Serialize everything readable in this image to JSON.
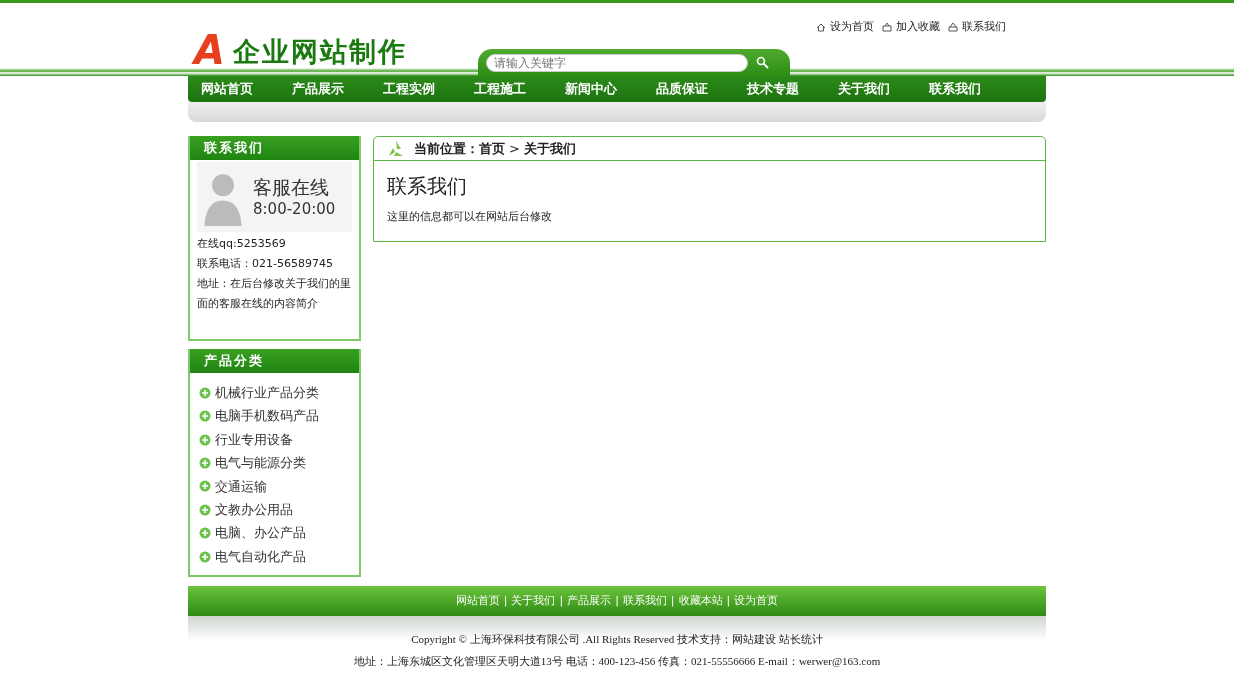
{
  "header": {
    "logo_letter": "A",
    "logo_text": "企业网站制作",
    "top_links": [
      {
        "kind": "home",
        "label": "设为首页"
      },
      {
        "kind": "favorite",
        "label": "加入收藏"
      },
      {
        "kind": "contact",
        "label": "联系我们"
      }
    ],
    "search": {
      "placeholder": "请输入关键字"
    }
  },
  "nav": [
    {
      "label": "网站首页",
      "selected": false
    },
    {
      "label": "产品展示",
      "selected": false
    },
    {
      "label": "工程实例",
      "selected": false
    },
    {
      "label": "工程施工",
      "selected": false
    },
    {
      "label": "新闻中心",
      "selected": false
    },
    {
      "label": "品质保证",
      "selected": false
    },
    {
      "label": "技术专题",
      "selected": false
    },
    {
      "label": "关于我们",
      "selected": false
    },
    {
      "label": "联系我们",
      "selected": false
    }
  ],
  "contact_box": {
    "title": "联系我们",
    "banner_title": "客服在线",
    "banner_hours": "8:00-20:00",
    "lines": [
      "在线qq:5253569",
      "联系电话：021-56589745",
      "地址：在后台修改关于我们的里面的客服在线的内容简介"
    ]
  },
  "category_box": {
    "title": "产品分类",
    "items": [
      "机械行业产品分类",
      "电脑手机数码产品",
      "行业专用设备",
      "电气与能源分类",
      "交通运输",
      "文教办公用品",
      "电脑、办公产品",
      "电气自动化产品"
    ]
  },
  "breadcrumb": {
    "label": "当前位置：",
    "items": [
      "首页",
      "关于我们"
    ],
    "separator": ">"
  },
  "article": {
    "title": "联系我们",
    "body": "这里的信息都可以在网站后台修改"
  },
  "footer": {
    "links": [
      "网站首页",
      "关于我们",
      "产品展示",
      "联系我们",
      "收藏本站",
      "设为首页"
    ],
    "separator": "|",
    "copyright": "Copyright © 上海环保科技有限公司 .All Rights Reserved 技术支持：网站建设 站长统计",
    "address": "地址：上海东城区文化管理区天明大道13号 电话：400-123-456 传真：021-55556666 E-mail：werwer@163.com"
  }
}
